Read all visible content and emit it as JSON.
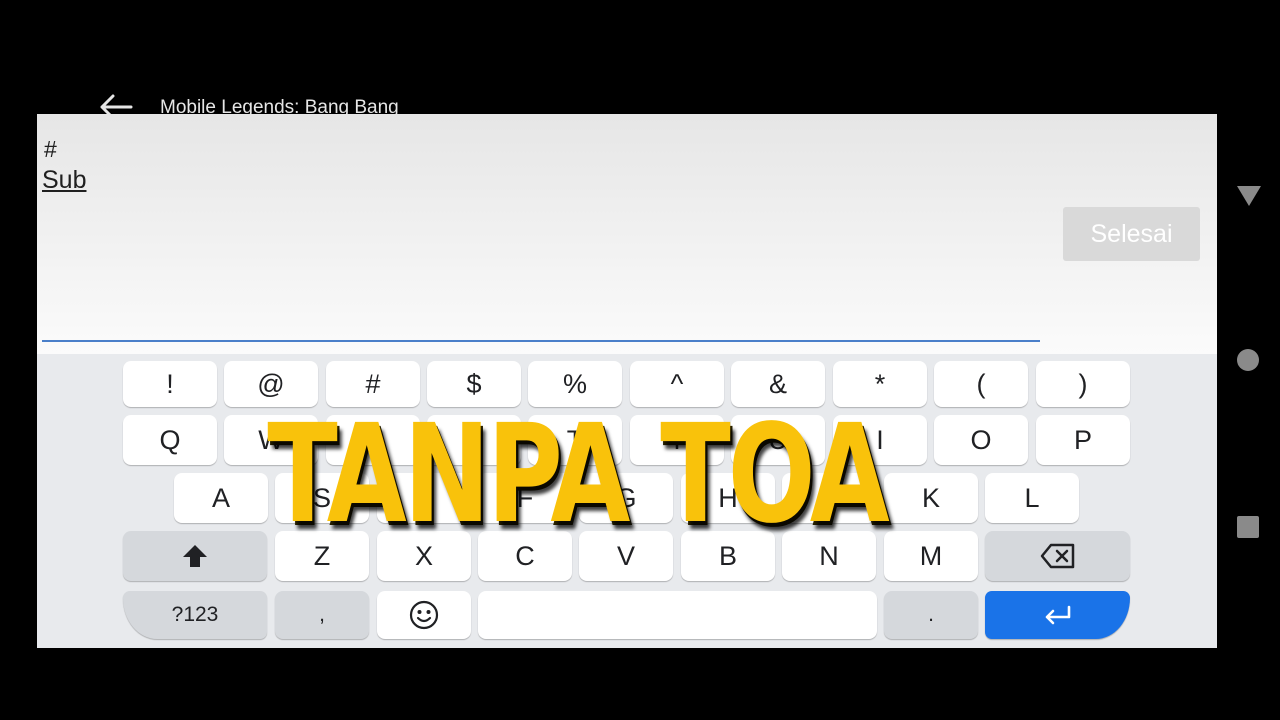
{
  "app_bar": {
    "title": "Mobile Legends: Bang Bang",
    "back_icon": "arrow-left-icon"
  },
  "input": {
    "line1": "#",
    "line2": "Sub"
  },
  "done_button": {
    "label": "Selesai"
  },
  "keyboard": {
    "row1": [
      "!",
      "@",
      "#",
      "$",
      "%",
      "^",
      "&",
      "*",
      "(",
      ")"
    ],
    "row2": [
      "Q",
      "W",
      "E",
      "R",
      "T",
      "Y",
      "U",
      "I",
      "O",
      "P"
    ],
    "row3": [
      "A",
      "S",
      "D",
      "F",
      "G",
      "H",
      "J",
      "K",
      "L"
    ],
    "row4": [
      "Z",
      "X",
      "C",
      "V",
      "B",
      "N",
      "M"
    ],
    "symbols_label": "?123",
    "comma": ",",
    "period": ".",
    "icons": {
      "shift": "shift-up-icon",
      "backspace": "backspace-icon",
      "emoji": "emoji-icon",
      "enter": "enter-icon"
    },
    "colors": {
      "enter": "#1a73e8",
      "func_key": "#d5d8dc",
      "key": "#ffffff"
    }
  },
  "overlay": {
    "text": "TANPA TOA",
    "color": "#f9c20b"
  },
  "nav_bar": {
    "back": "triangle-back-icon",
    "home": "circle-home-icon",
    "recents": "square-recents-icon"
  }
}
